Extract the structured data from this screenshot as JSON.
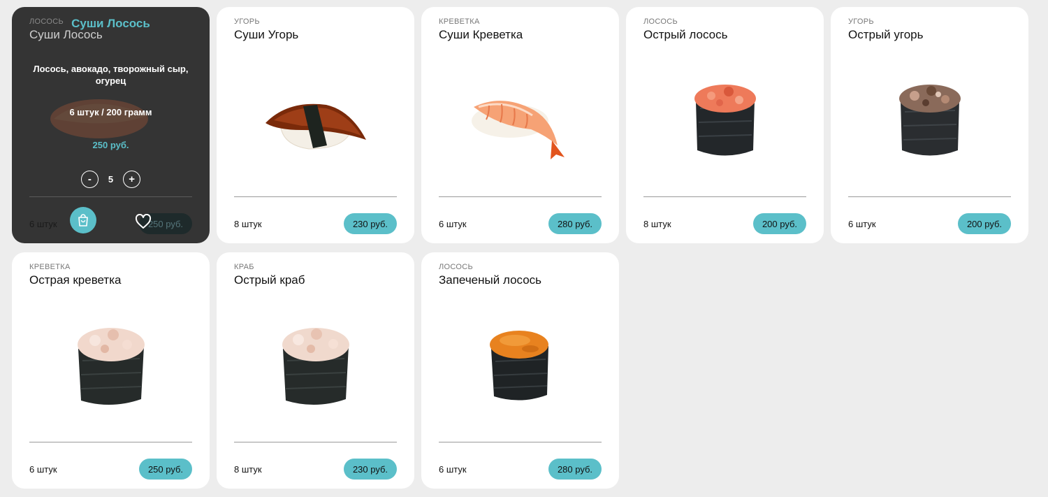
{
  "colors": {
    "accent": "#5bbfc9",
    "background": "#ededed",
    "card": "#ffffff",
    "card_hover": "#343434"
  },
  "hovered": {
    "name": "Суши Лосось",
    "description": "Лосось, авокадо, творожный сыр, огурец",
    "weight": "6 штук / 200 грамм",
    "price": "250 руб.",
    "quantity": "5",
    "minus": "-",
    "plus": "+"
  },
  "products": [
    {
      "category": "ЛОСОСЬ",
      "name": "Суши Лосось",
      "pieces": "6 штук",
      "price": "250 руб.",
      "image": "salmon-nigiri"
    },
    {
      "category": "УГОРЬ",
      "name": "Суши Угорь",
      "pieces": "8 штук",
      "price": "230 руб.",
      "image": "eel-nigiri"
    },
    {
      "category": "КРЕВЕТКА",
      "name": "Суши Креветка",
      "pieces": "6 штук",
      "price": "280 руб.",
      "image": "shrimp-nigiri"
    },
    {
      "category": "ЛОСОСЬ",
      "name": "Острый лосось",
      "pieces": "8 штук",
      "price": "200 руб.",
      "image": "spicy-salmon-gunkan"
    },
    {
      "category": "УГОРЬ",
      "name": "Острый угорь",
      "pieces": "6 штук",
      "price": "200 руб.",
      "image": "spicy-eel-gunkan"
    },
    {
      "category": "КРЕВЕТКА",
      "name": "Острая креветка",
      "pieces": "6 штук",
      "price": "250 руб.",
      "image": "spicy-shrimp-gunkan"
    },
    {
      "category": "КРАБ",
      "name": "Острый краб",
      "pieces": "8 штук",
      "price": "230 руб.",
      "image": "spicy-crab-gunkan"
    },
    {
      "category": "ЛОСОСЬ",
      "name": "Запеченый лосось",
      "pieces": "6 штук",
      "price": "280 руб.",
      "image": "baked-salmon-gunkan"
    }
  ]
}
